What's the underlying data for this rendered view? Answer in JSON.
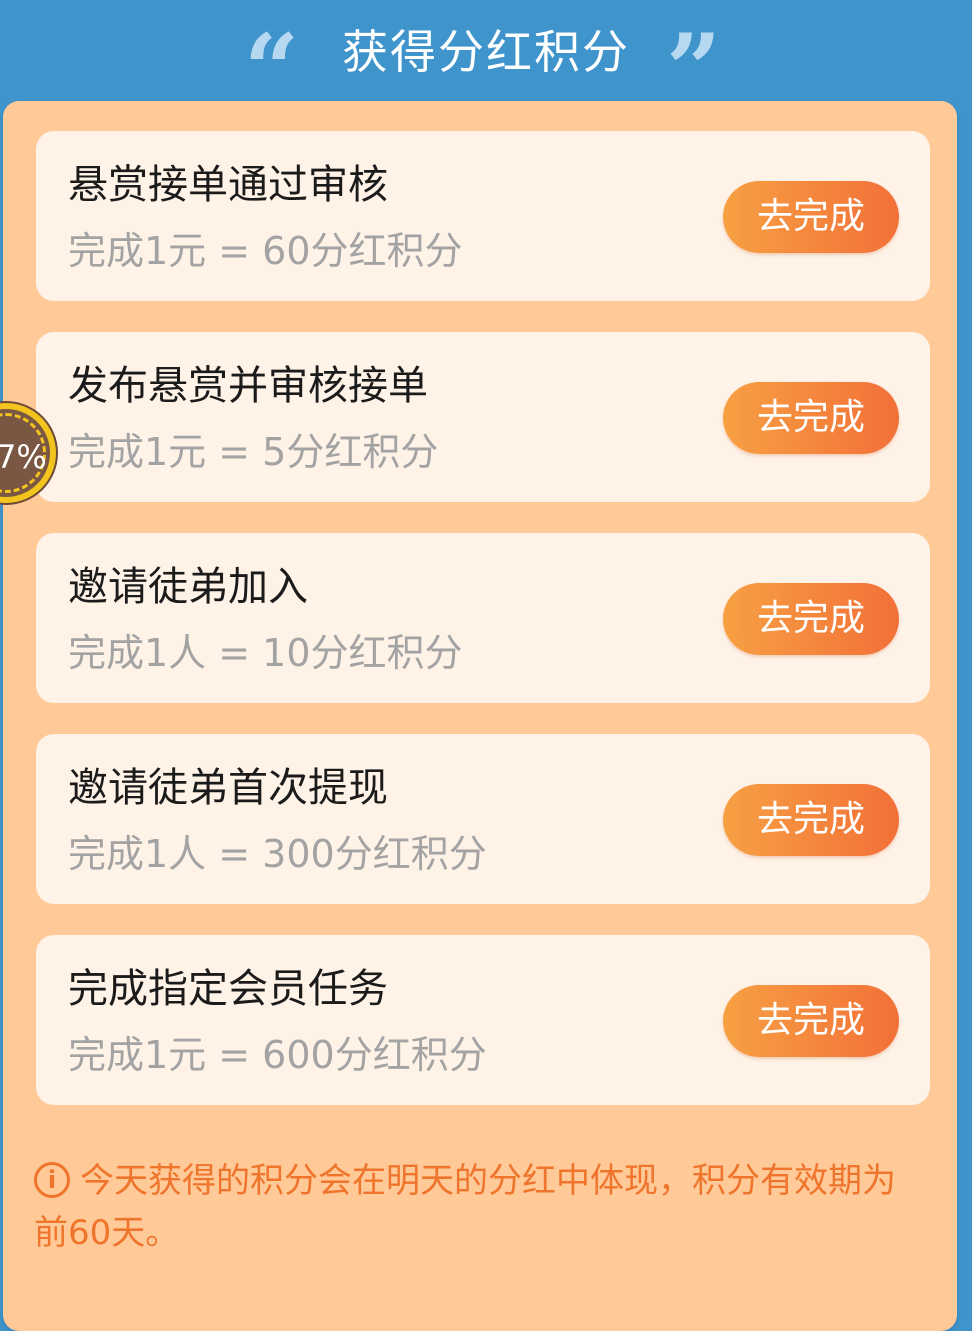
{
  "header": {
    "title": "获得分红积分",
    "quote_open": "“",
    "quote_close": "”"
  },
  "tasks": [
    {
      "title": "悬赏接单通过审核",
      "desc": "完成1元 = 60分红积分",
      "button": "去完成"
    },
    {
      "title": "发布悬赏并审核接单",
      "desc": "完成1元 = 5分红积分",
      "button": "去完成"
    },
    {
      "title": "邀请徒弟加入",
      "desc": "完成1人 = 10分红积分",
      "button": "去完成"
    },
    {
      "title": "邀请徒弟首次提现",
      "desc": "完成1人 = 300分红积分",
      "button": "去完成"
    },
    {
      "title": "完成指定会员任务",
      "desc": "完成1元 = 600分红积分",
      "button": "去完成"
    }
  ],
  "notice": {
    "icon": "info-icon",
    "icon_glyph": "i",
    "text": "今天获得的积分会在明天的分红中体现，积分有效期为前60天。"
  },
  "float_widget": {
    "text": "7%"
  },
  "colors": {
    "header_bg": "#3f94cc",
    "panel_bg": "#ffc998",
    "card_bg": "#fff3e8",
    "button_start": "#f7a043",
    "button_end": "#f27038",
    "notice_text": "#f0752c"
  }
}
